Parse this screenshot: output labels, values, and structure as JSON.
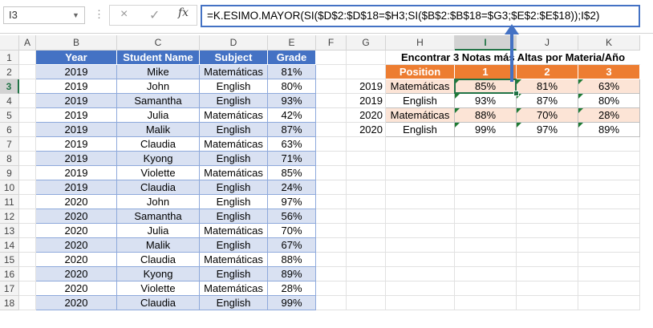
{
  "formula_bar": {
    "name_box": "I3",
    "cancel_icon": "×",
    "enter_icon": "✓",
    "fx_label": "fx",
    "formula": "=K.ESIMO.MAYOR(SI($D$2:$D$18=$H3;SI($B$2:$B$18=$G3;$E$2:$E$18));I$2)"
  },
  "columns": [
    "A",
    "B",
    "C",
    "D",
    "E",
    "F",
    "G",
    "H",
    "I",
    "J",
    "K"
  ],
  "rows": [
    "1",
    "2",
    "3",
    "4",
    "5",
    "6",
    "7",
    "8",
    "9",
    "10",
    "11",
    "12",
    "13",
    "14",
    "15",
    "16",
    "17",
    "18"
  ],
  "selected_cell": "I3",
  "source_table": {
    "headers": [
      "Year",
      "Student Name",
      "Subject",
      "Grade"
    ],
    "rows": [
      [
        "2019",
        "Mike",
        "Matemáticas",
        "81%"
      ],
      [
        "2019",
        "John",
        "English",
        "80%"
      ],
      [
        "2019",
        "Samantha",
        "English",
        "93%"
      ],
      [
        "2019",
        "Julia",
        "Matemáticas",
        "42%"
      ],
      [
        "2019",
        "Malik",
        "English",
        "87%"
      ],
      [
        "2019",
        "Claudia",
        "Matemáticas",
        "63%"
      ],
      [
        "2019",
        "Kyong",
        "English",
        "71%"
      ],
      [
        "2019",
        "Violette",
        "Matemáticas",
        "85%"
      ],
      [
        "2019",
        "Claudia",
        "English",
        "24%"
      ],
      [
        "2020",
        "John",
        "English",
        "97%"
      ],
      [
        "2020",
        "Samantha",
        "English",
        "56%"
      ],
      [
        "2020",
        "Julia",
        "Matemáticas",
        "70%"
      ],
      [
        "2020",
        "Malik",
        "English",
        "67%"
      ],
      [
        "2020",
        "Claudia",
        "Matemáticas",
        "88%"
      ],
      [
        "2020",
        "Kyong",
        "English",
        "89%"
      ],
      [
        "2020",
        "Violette",
        "Matemáticas",
        "28%"
      ],
      [
        "2020",
        "Claudia",
        "English",
        "99%"
      ]
    ]
  },
  "result_table": {
    "title": "Encontrar 3 Notas más Altas por Materia/Año",
    "position_label": "Position",
    "positions": [
      "1",
      "2",
      "3"
    ],
    "rows": [
      {
        "year": "2019",
        "subject": "Matemáticas",
        "values": [
          "85%",
          "81%",
          "63%"
        ]
      },
      {
        "year": "2019",
        "subject": "English",
        "values": [
          "93%",
          "87%",
          "80%"
        ]
      },
      {
        "year": "2020",
        "subject": "Matemáticas",
        "values": [
          "88%",
          "70%",
          "28%"
        ]
      },
      {
        "year": "2020",
        "subject": "English",
        "values": [
          "99%",
          "97%",
          "89%"
        ]
      }
    ]
  },
  "colors": {
    "header_blue": "#4472c4",
    "band_blue": "#d9e1f2",
    "header_orange": "#ed7d31",
    "band_peach": "#fce4d6",
    "excel_green": "#217346"
  }
}
